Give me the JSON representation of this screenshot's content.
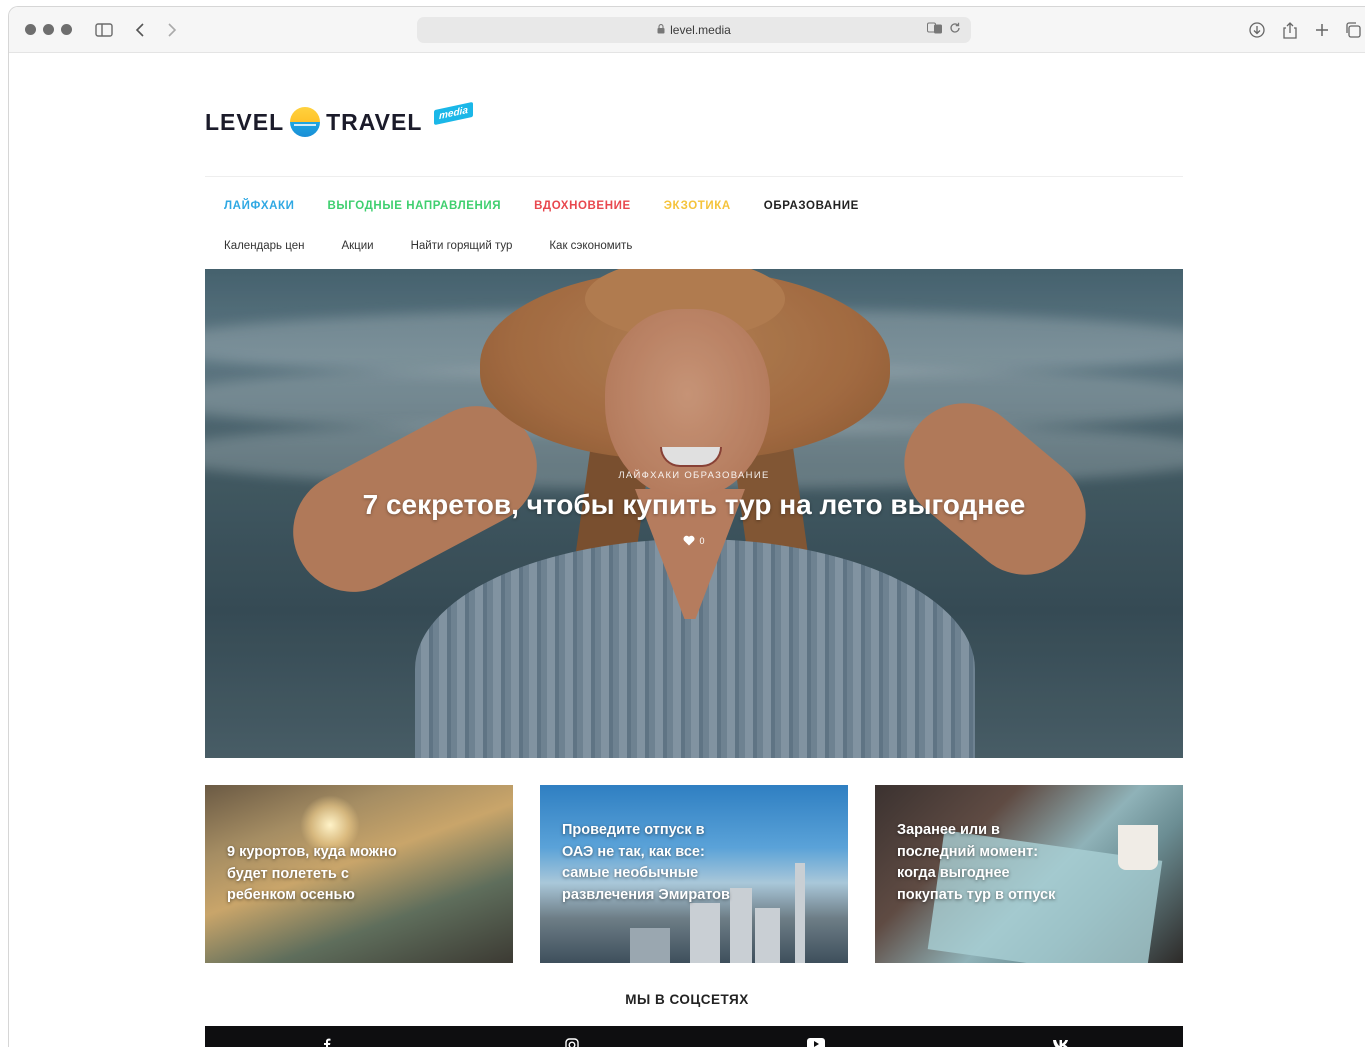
{
  "browser": {
    "url": "level.media"
  },
  "logo": {
    "left_word": "LEVEL",
    "right_word": "TRAVEL",
    "badge": "media"
  },
  "categories": [
    {
      "label": "ЛАЙФХАКИ",
      "color": "#2fa8e3"
    },
    {
      "label": "ВЫГОДНЫЕ НАПРАВЛЕНИЯ",
      "color": "#3fcf6f"
    },
    {
      "label": "ВДОХНОВЕНИЕ",
      "color": "#e8474e"
    },
    {
      "label": "ЭКЗОТИКА",
      "color": "#f5c33b"
    },
    {
      "label": "ОБРАЗОВАНИЕ",
      "color": "#222222"
    }
  ],
  "subnav": [
    "Календарь цен",
    "Акции",
    "Найти горящий тур",
    "Как сэкономить"
  ],
  "hero": {
    "tags": "ЛАЙФХАКИ ОБРАЗОВАНИЕ",
    "title": "7 секретов, чтобы купить тур на лето выгоднее",
    "likes": "0"
  },
  "cards": [
    {
      "title": "9 курортов, куда можно будет полететь с ребенком осенью"
    },
    {
      "title": "Проведите отпуск в ОАЭ не так, как все: самые необычные развлечения Эмиратов"
    },
    {
      "title": "Заранее или в последний момент: когда выгоднее покупать тур в отпуск"
    }
  ],
  "social": {
    "title": "МЫ В СОЦСЕТЯХ",
    "icons": [
      "facebook-icon",
      "instagram-icon",
      "youtube-icon",
      "vk-icon"
    ]
  }
}
